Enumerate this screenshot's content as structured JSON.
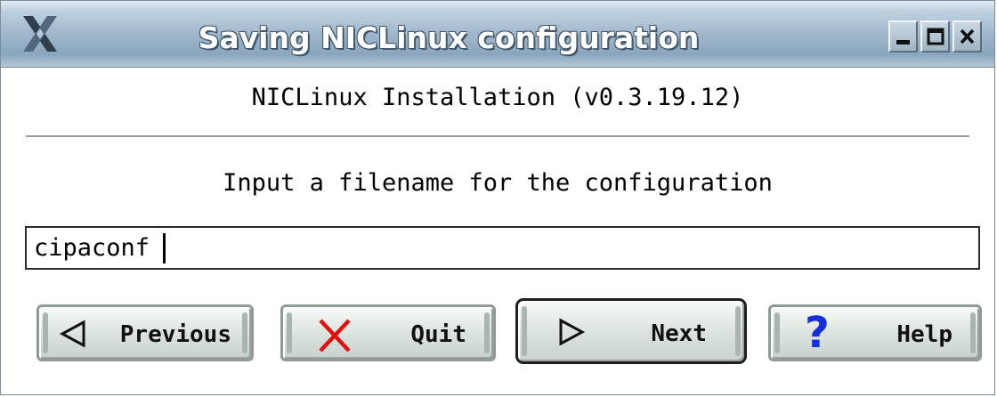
{
  "window": {
    "title": "Saving NICLinux configuration",
    "controls": [
      "minimize-icon",
      "maximize-icon",
      "close-icon"
    ]
  },
  "main": {
    "heading": "NICLinux Installation (v0.3.19.12)",
    "prompt": "Input a filename for the configuration",
    "filename": {
      "value": "cipaconf",
      "placeholder": ""
    }
  },
  "buttons": {
    "previous": {
      "label": "Previous",
      "icon": "left-triangle-icon"
    },
    "quit": {
      "label": "Quit",
      "icon": "red-x-icon"
    },
    "next": {
      "label": "Next",
      "icon": "right-triangle-icon"
    },
    "help": {
      "label": "Help",
      "icon": "blue-question-icon"
    }
  },
  "colors": {
    "titlebar": "#9db5c9",
    "quit_icon": "#e01010",
    "help_icon": "#1530d8"
  }
}
